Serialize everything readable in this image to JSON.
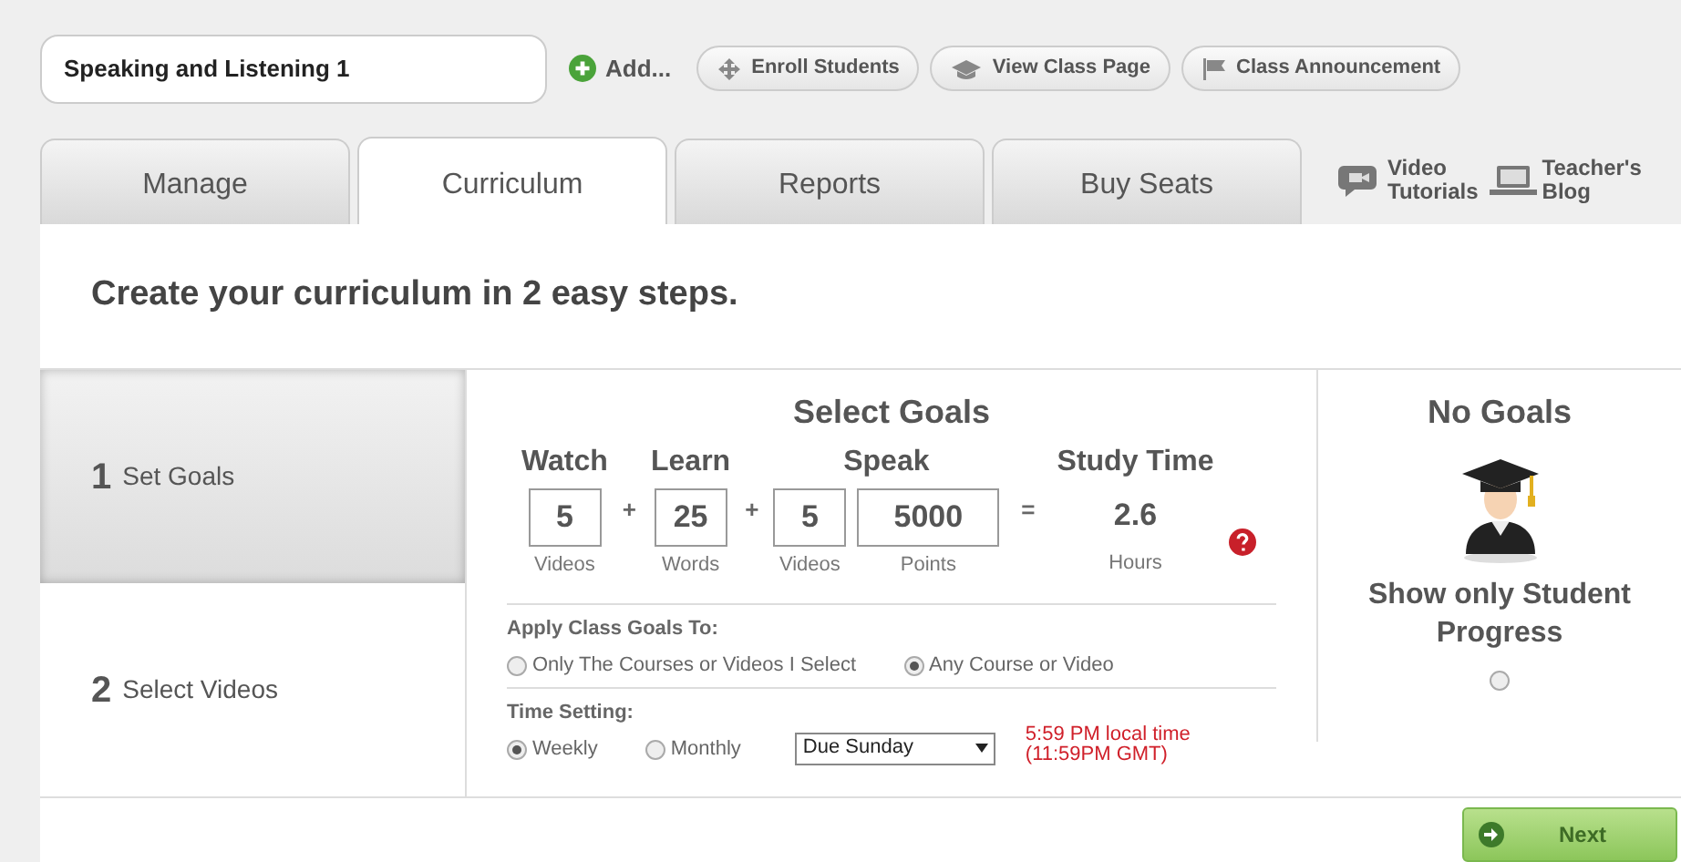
{
  "class_name": {
    "value": "Speaking and Listening 1"
  },
  "add_button": "Add...",
  "toolbar_buttons": [
    {
      "label": "Enroll Students",
      "kind": "enroll"
    },
    {
      "label": "View Class Page",
      "kind": "class"
    },
    {
      "label": "Class Announcement",
      "kind": "flag"
    }
  ],
  "tabs": [
    {
      "label": "Manage",
      "selected": false
    },
    {
      "label": "Curriculum",
      "selected": true
    },
    {
      "label": "Reports",
      "selected": false
    },
    {
      "label": "Buy Seats",
      "selected": false
    }
  ],
  "help_links": [
    {
      "lines": [
        "Video",
        "Tutorials"
      ],
      "kind": "video"
    },
    {
      "lines": [
        "Teacher's",
        "Blog"
      ],
      "kind": "blog"
    }
  ],
  "heading": "Create your curriculum in 2 easy steps.",
  "steps": [
    {
      "number": "1",
      "label": "Set Goals",
      "selected": true
    },
    {
      "number": "2",
      "label": "Select Videos",
      "selected": false
    }
  ],
  "goals": {
    "title": "Select Goals",
    "groups": [
      {
        "heading": "Watch",
        "fields": [
          {
            "value": "5",
            "unit": "Videos"
          }
        ]
      },
      {
        "heading": "Learn",
        "operator": "+",
        "fields": [
          {
            "value": "25",
            "unit": "Words"
          }
        ]
      },
      {
        "heading": "Speak",
        "operator": "+",
        "fields": [
          {
            "value": "5",
            "unit": "Videos"
          },
          {
            "value": "5000",
            "unit": "Points"
          }
        ]
      }
    ],
    "equals": "=",
    "study_time": {
      "heading": "Study Time",
      "value": "2.6",
      "unit": "Hours"
    }
  },
  "apply_goals": {
    "label": "Apply Class Goals To:",
    "options": [
      {
        "label": "Only The Courses or Videos I Select",
        "selected": false
      },
      {
        "label": "Any Course or Video",
        "selected": true
      }
    ]
  },
  "time_setting": {
    "label": "Time Setting:",
    "options": [
      {
        "label": "Weekly",
        "selected": true
      },
      {
        "label": "Monthly",
        "selected": false
      }
    ],
    "due": "Due Sunday",
    "deadline": [
      "5:59 PM local time",
      "(11:59PM GMT)"
    ]
  },
  "no_goals": {
    "title": "No Goals",
    "option_label": "Show only Student Progress",
    "selected": false
  },
  "next_button": "Next"
}
